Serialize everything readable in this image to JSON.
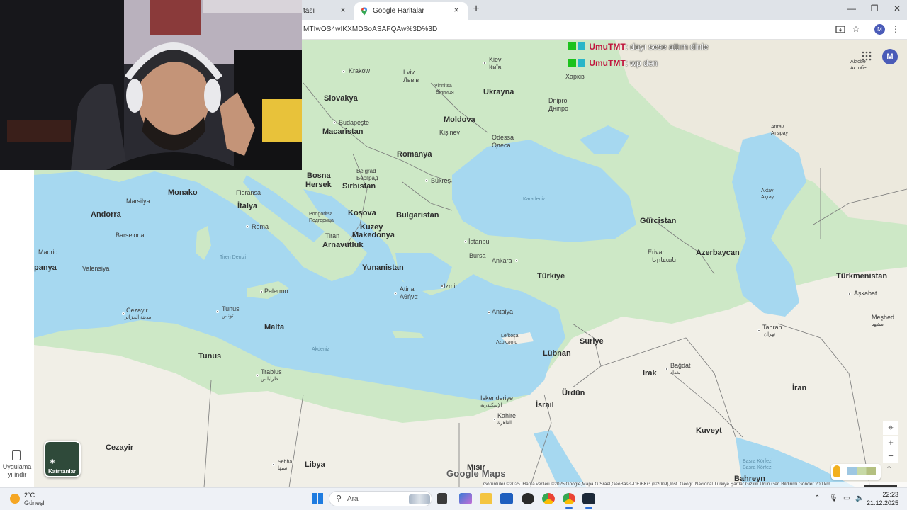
{
  "browser": {
    "prev_tab_label": "tası",
    "active_tab_label": "Google Haritalar",
    "new_tab_glyph": "+",
    "close_glyph": "×",
    "url": "MTIwOS4wIKXMDSoASAFQAw%3D%3D",
    "window_controls": {
      "minimize": "—",
      "maximize": "❐",
      "close": "✕"
    },
    "profile_initial": "M"
  },
  "left_rail": {
    "app_download_label": "Uygulama yı indir"
  },
  "map": {
    "chat": [
      {
        "user": "UmuTMT",
        "message": ": dayı sese attım dinle"
      },
      {
        "user": "UmuTMT",
        "message": ": wp den"
      }
    ],
    "avatar_initial": "M",
    "layers_label": "Katmanlar",
    "google_logo": "Google Maps",
    "attribution": "Görüntüler ©2025 ,Harita verileri ©2025 Google,Mapa GISrael,GeoBasis-DE/BKG (©2009),Inst. Geogr. Nacional    Türkiye    Şartlar    Gizlilik    Ürün Geri Bildirimi Gönder    200 km",
    "zoom_in": "+",
    "zoom_out": "−",
    "labels": {
      "kiev": "Kiev",
      "kiev_local": "Київ",
      "krakow": "Kraków",
      "lviv": "Lviv",
      "lviv_local": "Львів",
      "vinnitsa": "Vinnitsa",
      "vinnitsa_local": "Вінниця",
      "ukrayna": "Ukrayna",
      "kharkiv": "Харків",
      "dnipro": "Dnipro",
      "dnipro_local": "Дніпро",
      "slovakya": "Slovakya",
      "moldova": "Moldova",
      "budapeste": "Budapeşte",
      "kisinev": "Kişinev",
      "macaristan": "Macaristan",
      "odessa": "Odessa",
      "odessa_local": "Одеса",
      "romanya": "Romanya",
      "bosna": "Bosna",
      "hersek": "Hersek",
      "belgrad": "Belgrad",
      "belgrad_local": "Београд",
      "sirbistan": "Sırbistan",
      "bukres": "Bükreş",
      "karadeniz": "Karadeniz",
      "monako": "Monako",
      "floransa": "Floransa",
      "marsilya": "Marsilya",
      "italya": "İtalya",
      "bulgaristan": "Bulgaristan",
      "podgoritsa": "Podgoritsa",
      "podgoritsa_local": "Подгорица",
      "kosova": "Kosova",
      "andorra": "Andorra",
      "barselona": "Barselona",
      "roma": "Roma",
      "kuzey": "Kuzey",
      "makedonya": "Makedonya",
      "tiran": "Tiran",
      "arnavutluk": "Arnavutluk",
      "istanbul": "İstanbul",
      "gurcistan": "Gürcistan",
      "madrid": "Madrid",
      "panya": "panya",
      "valensiya": "Valensiya",
      "tiren_denizi": "Tiren Denizi",
      "bursa": "Bursa",
      "ankara": "Ankara",
      "yunanistan": "Yunanistan",
      "erivan": "Erivan",
      "erivan_local": "Երևան",
      "azerbaycan": "Azerbaycan",
      "turkiye": "Türkiye",
      "palermo": "Palermo",
      "atina": "Atina",
      "atina_local": "Αθήνα",
      "izmir": "İzmir",
      "turkmenistan": "Türkmenistan",
      "askabat": "Aşkabat",
      "cezayir_city": "Cezayir",
      "cezayir_city_local": "مدينة الجزائر",
      "tunus_city": "Tunus",
      "tunus_city_local": "تونس",
      "antalya": "Antalya",
      "meshed": "Meşhed",
      "meshed_local": "مشهد",
      "malta": "Malta",
      "tahran": "Tahran",
      "tahran_local": "تهران",
      "akdeniz": "Akdeniz",
      "lefkosa": "Lefkoşa",
      "lefkosa_local": "Λευκωσία",
      "suriye": "Suriye",
      "lubnan": "Lübnan",
      "tunus": "Tunus",
      "bagdat": "Bağdat",
      "bagdat_local": "بغداد",
      "trablus": "Trablus",
      "trablus_local": "طرابلس",
      "irak": "Irak",
      "iskenderiye": "İskenderiye",
      "iskenderiye_local": "الإسكندرية",
      "urdun": "Ürdün",
      "israil": "İsrail",
      "iran": "İran",
      "kahire": "Kahire",
      "kahire_local": "القاهرة",
      "kuveyt": "Kuveyt",
      "cezayir": "Cezayir",
      "libya": "Libya",
      "sebha": "Sebha",
      "sebha_local": "سبها",
      "misir": "Mısır",
      "basra": "Basra Körfezi",
      "basra_local": "Basra Körfezi",
      "bahreyn": "Bahreyn",
      "aktobe": "Aktöbe",
      "aktobe_local": "Актобе",
      "atirav": "Atırav",
      "atirav_local": "Атырау",
      "aktav": "Aktav",
      "aktav_local": "Ақтау"
    }
  },
  "taskbar": {
    "weather_temp": "2°C",
    "weather_desc": "Güneşli",
    "search_placeholder": "Ara",
    "clock_time": "22:23",
    "clock_date": "21.12.2025"
  },
  "colors": {
    "water": "#a6d8f0",
    "land_green": "#cde8c6",
    "land_desert": "#f1efe7",
    "border": "#7a7a7a",
    "chat_user": "#c0143c",
    "taskbar_bg": "#eef1f6"
  }
}
